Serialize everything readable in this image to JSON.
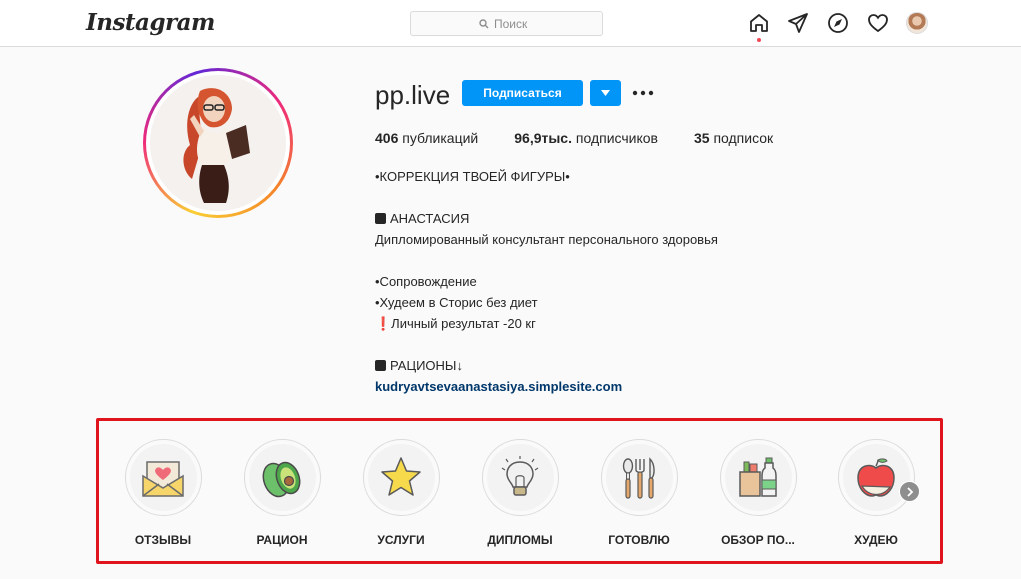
{
  "app": {
    "logo_text": "Instagram"
  },
  "search": {
    "placeholder": "Поиск",
    "icon": "search-icon"
  },
  "nav": {
    "icons": [
      "home-icon",
      "direct-icon",
      "explore-icon",
      "heart-icon",
      "avatar"
    ],
    "notification_color": "#ed4956"
  },
  "profile": {
    "username": "pp.live",
    "follow_label": "Подписаться",
    "accent": "#0095f6",
    "stats": {
      "posts_value": "406",
      "posts_label": "публикаций",
      "followers_value": "96,9тыс.",
      "followers_label": "подписчиков",
      "following_value": "35",
      "following_label": "подписок"
    },
    "bio": {
      "line1": "•КОРРЕКЦИЯ ТВОЕЙ ФИГУРЫ•",
      "line2": "АНАСТАСИЯ",
      "line3": "Дипломированный консультант персонального здоровья",
      "line4": "•Сопровождение",
      "line5": "•Худеем в Сторис без диет",
      "line6": "❗Личный результат -20 кг",
      "line7": "РАЦИОНЫ↓",
      "link": "kudryavtsevaanastasiya.simplesite.com"
    }
  },
  "highlights": [
    {
      "label": "ОТЗЫВЫ",
      "icon": "envelope-heart-icon"
    },
    {
      "label": "РАЦИОН",
      "icon": "avocado-icon"
    },
    {
      "label": "УСЛУГИ",
      "icon": "star-icon"
    },
    {
      "label": "ДИПЛОМЫ",
      "icon": "lightbulb-icon"
    },
    {
      "label": "ГОТОВЛЮ",
      "icon": "cutlery-icon"
    },
    {
      "label": "ОБЗОР ПО...",
      "icon": "groceries-icon"
    },
    {
      "label": "ХУДЕЮ",
      "icon": "apple-icon"
    }
  ],
  "highlight_frame_color": "#e0141c"
}
